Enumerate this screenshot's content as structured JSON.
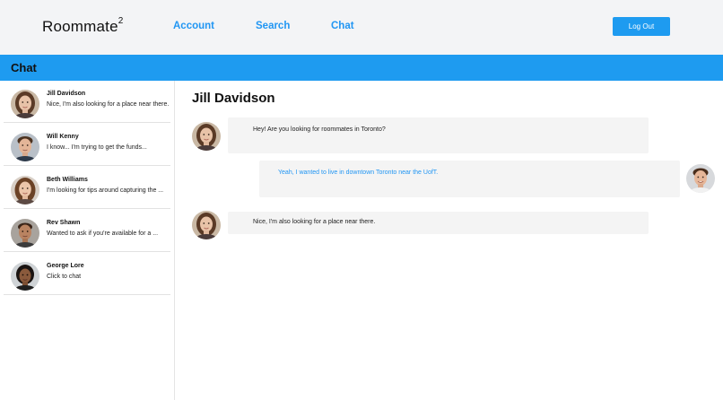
{
  "header": {
    "logo_text": "Roommate",
    "logo_sup": "2",
    "nav": {
      "account": "Account",
      "search": "Search",
      "chat": "Chat"
    },
    "logout_label": "Log Out"
  },
  "section": {
    "title": "Chat"
  },
  "sidebar": {
    "contacts": [
      {
        "name": "Jill Davidson",
        "preview": "Nice, I'm also looking for a place near there."
      },
      {
        "name": "Will Kenny",
        "preview": "I know... I'm trying to get the funds..."
      },
      {
        "name": "Beth Williams",
        "preview": "I'm looking for tips around capturing the ..."
      },
      {
        "name": "Rev Shawn",
        "preview": "Wanted to ask if you're available for a ..."
      },
      {
        "name": "George Lore",
        "preview": "Click to chat"
      }
    ]
  },
  "conversation": {
    "title": "Jill Davidson",
    "messages": [
      {
        "sender": "them",
        "text": "Hey! Are you looking for roommates in Toronto?"
      },
      {
        "sender": "me",
        "text": "Yeah, I wanted to live in downtown Toronto near the UofT."
      },
      {
        "sender": "them",
        "text": "Nice, I'm also looking for a place near there."
      }
    ]
  },
  "colors": {
    "accent": "#1e9bf0",
    "nav_link": "#2196f3",
    "my_message_text": "#2196f3",
    "bubble_bg": "#f4f4f4",
    "topbar_bg": "#f3f4f6"
  }
}
